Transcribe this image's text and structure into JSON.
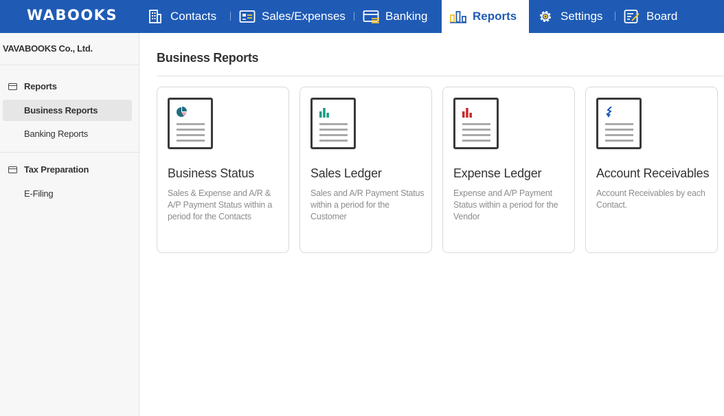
{
  "app": {
    "logo": "WABOOKS"
  },
  "nav": {
    "items": [
      {
        "label": "Contacts",
        "icon": "building-icon"
      },
      {
        "label": "Sales/Expenses",
        "icon": "invoice-icon"
      },
      {
        "label": "Banking",
        "icon": "card-icon"
      },
      {
        "label": "Reports",
        "icon": "bar-chart-icon",
        "active": true
      },
      {
        "label": "Settings",
        "icon": "gear-icon"
      },
      {
        "label": "Board",
        "icon": "notepad-icon"
      }
    ]
  },
  "sidebar": {
    "company": "VAVABOOKS Co., Ltd.",
    "sections": [
      {
        "heading": "Reports",
        "items": [
          "Business Reports",
          "Banking Reports"
        ]
      },
      {
        "heading": "Tax Preparation",
        "items": [
          "E-Filing"
        ]
      }
    ],
    "active_item": "Business Reports"
  },
  "main": {
    "title": "Business Reports",
    "cards": [
      {
        "title": "Business Status",
        "description": "Sales & Expense and A/R & A/P Payment Status within a period for the Contacts",
        "icon": "pie-chart-icon"
      },
      {
        "title": "Sales Ledger",
        "description": "Sales and A/R Payment Status within a period for the Customer",
        "icon": "bar-chart-icon"
      },
      {
        "title": "Expense Ledger",
        "description": "Expense and A/P Payment Status within a period for the Vendor",
        "icon": "bar-chart-icon"
      },
      {
        "title": "Account Receivables",
        "description": "Account Receivables by each Contact.",
        "icon": "arrow-down-icon"
      }
    ]
  },
  "colors": {
    "brand_blue": "#1f5bb5",
    "active_nav_bg": "#ffffff",
    "sales_green": "#1a9a86",
    "expense_red": "#c62a2a",
    "receivable_blue": "#1f5bb5",
    "pie_teal": "#1f6e80",
    "pie_pink": "#e9a3b4"
  }
}
